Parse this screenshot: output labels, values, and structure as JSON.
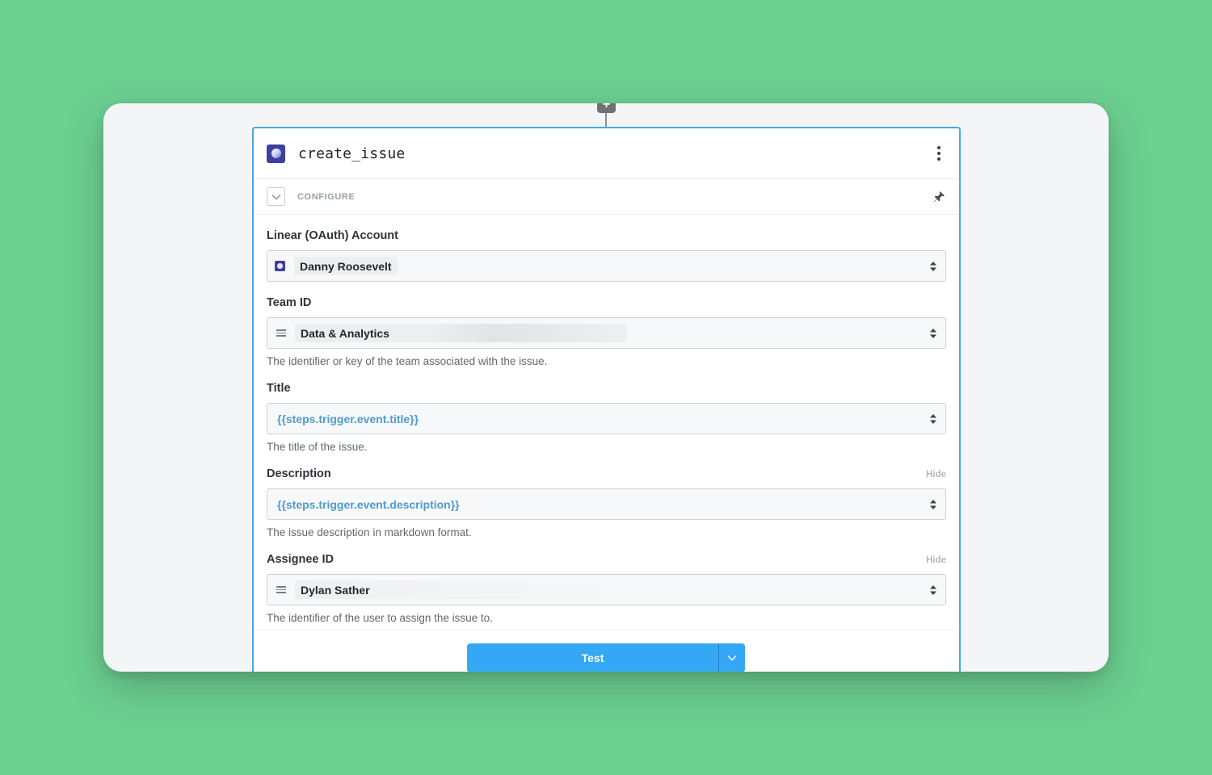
{
  "step": {
    "title": "create_issue",
    "configure_label": "CONFIGURE"
  },
  "fields": {
    "account": {
      "label": "Linear (OAuth) Account",
      "value": "Danny Roosevelt"
    },
    "team": {
      "label": "Team ID",
      "value": "Data & Analytics",
      "help": "The identifier or key of the team associated with the issue."
    },
    "title": {
      "label": "Title",
      "value": "{{steps.trigger.event.title}}",
      "help": "The title of the issue."
    },
    "description": {
      "label": "Description",
      "hide": "Hide",
      "value": "{{steps.trigger.event.description}}",
      "help": "The issue description in markdown format."
    },
    "assignee": {
      "label": "Assignee ID",
      "hide": "Hide",
      "value": "Dylan Sather",
      "help": "The identifier of the user to assign the issue to."
    }
  },
  "actions": {
    "test_label": "Test"
  },
  "colors": {
    "background": "#6cd091",
    "accent": "#35a8f5",
    "expression": "#4d9bcf",
    "card_border": "#4aa8ea"
  }
}
